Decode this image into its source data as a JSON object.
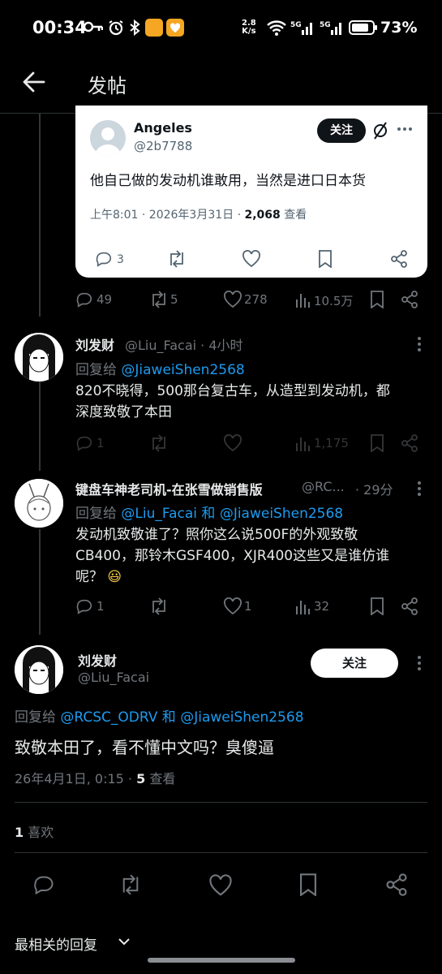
{
  "status_bar": {
    "time": "00:34",
    "speed_value": "2.8",
    "speed_unit": "K/s",
    "battery_pct": "73%"
  },
  "header": {
    "title": "发帖",
    "back_icon": "arrow-left-icon"
  },
  "quoted_post": {
    "name": "Angeles",
    "handle": "@2b7788",
    "follow_label": "关注",
    "text": "他自己做的发动机谁敢用，当然是进口日本货",
    "meta_time": "上午8:01 · 2026年3月31日 · ",
    "views_count": "2,068",
    "views_label": " 查看",
    "reply_count": "3"
  },
  "parent_actions": {
    "replies": "49",
    "reposts": "5",
    "likes": "278",
    "views": "10.5万"
  },
  "reply1": {
    "name": "刘发财",
    "handle": "@Liu_Facai · 4小时",
    "reply_prefix": "回复给 ",
    "reply_to": "@JiaweiShen2568",
    "text_line1": "820不晓得，500那台复古车，从造型到发动机，都",
    "text_line2": "深度致敬了本田",
    "replies": "1",
    "views": "1,175"
  },
  "reply2": {
    "name": "键盘车神老司机-在张雪做销售版",
    "handle": "@RC...",
    "time": "· 29分",
    "reply_prefix": "回复给 ",
    "reply_to_a": "@Liu_Facai",
    "reply_and": " 和 ",
    "reply_to_b": "@JiaweiShen2568",
    "text_line1": "发动机致敬谁了？照你这么说500F的外观致敬",
    "text_line2": "CB400，那铃木GSF400，XJR400这些又是谁仿谁",
    "text_line3": "呢？",
    "emoji": "😃",
    "replies": "1",
    "likes": "1",
    "views": "32"
  },
  "main_post": {
    "name": "刘发财",
    "handle": "@Liu_Facai",
    "follow_label": "关注",
    "reply_prefix": "回复给 ",
    "reply_to_a": "@RCSC_ODRV",
    "reply_and": " 和 ",
    "reply_to_b": "@JiaweiShen2568",
    "text": "致敬本田了，看不懂中文吗？臭傻逼",
    "meta_time": "26年4月1日, 0:15 · ",
    "views_count": "5",
    "views_label": " 查看",
    "likes_count": "1",
    "likes_label": " 喜欢"
  },
  "footer": {
    "sort_label": "最相关的回复"
  },
  "colors": {
    "accent": "#1d9bf0",
    "bg": "#000000",
    "muted": "#71767b",
    "text": "#e7e9ea"
  }
}
